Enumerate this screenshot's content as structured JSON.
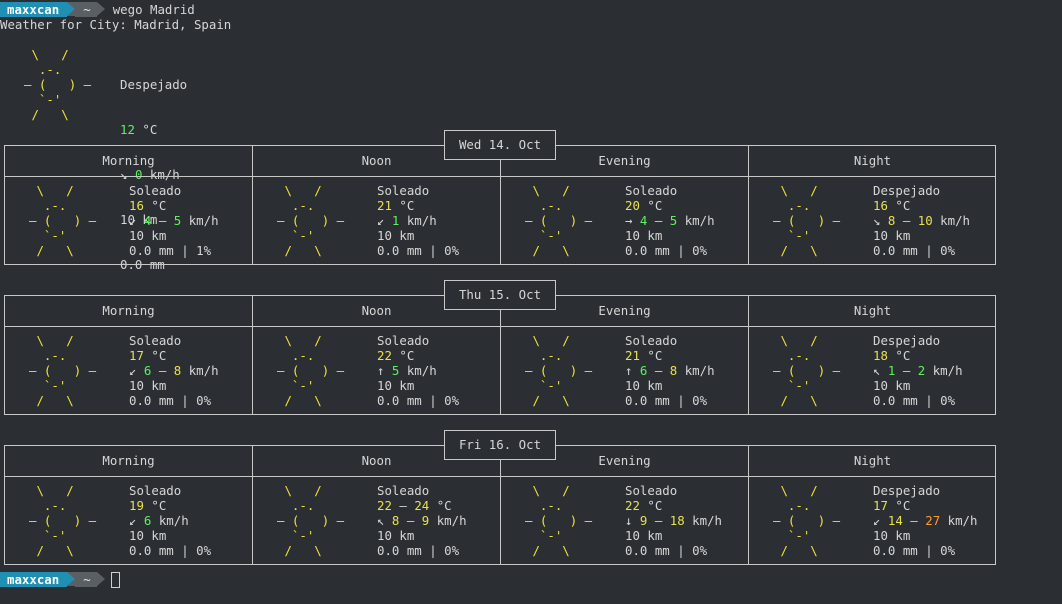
{
  "prompt": {
    "user": "maxxcan",
    "dir": "~",
    "command": "wego Madrid"
  },
  "header": "Weather for City: Madrid, Spain",
  "current": {
    "condition": "Despejado",
    "temp": "12",
    "temp_unit": " °C",
    "wind_arrow": "↘",
    "wind": "0",
    "wind_unit": " km/h",
    "visibility": "10 km",
    "precip": "0.0 mm"
  },
  "sun_art": [
    " \\   /",
    "  .-.",
    "― (   ) ―",
    "  `-'",
    " /   \\"
  ],
  "periods": [
    "Morning",
    "Noon",
    "Evening",
    "Night"
  ],
  "days": [
    {
      "date": "Wed 14. Oct",
      "slots": [
        {
          "cond": "Soleado",
          "temp": [
            "16"
          ],
          "arrow": "↙",
          "wind": [
            {
              "v": "4",
              "c": "g"
            },
            {
              "v": "5",
              "c": "g"
            }
          ],
          "vis": "10 km",
          "precip": "0.0 mm | 1%"
        },
        {
          "cond": "Soleado",
          "temp": [
            "21"
          ],
          "arrow": "↙",
          "wind": [
            {
              "v": "1",
              "c": "g"
            }
          ],
          "vis": "10 km",
          "precip": "0.0 mm | 0%"
        },
        {
          "cond": "Soleado",
          "temp": [
            "20"
          ],
          "arrow": "→",
          "wind": [
            {
              "v": "4",
              "c": "g"
            },
            {
              "v": "5",
              "c": "g"
            }
          ],
          "vis": "10 km",
          "precip": "0.0 mm | 0%"
        },
        {
          "cond": "Despejado",
          "temp": [
            "16"
          ],
          "arrow": "↘",
          "wind": [
            {
              "v": "8",
              "c": "y"
            },
            {
              "v": "10",
              "c": "y"
            }
          ],
          "vis": "10 km",
          "precip": "0.0 mm | 0%"
        }
      ]
    },
    {
      "date": "Thu 15. Oct",
      "slots": [
        {
          "cond": "Soleado",
          "temp": [
            "17"
          ],
          "arrow": "↙",
          "wind": [
            {
              "v": "6",
              "c": "g"
            },
            {
              "v": "8",
              "c": "y"
            }
          ],
          "vis": "10 km",
          "precip": "0.0 mm | 0%"
        },
        {
          "cond": "Soleado",
          "temp": [
            "22"
          ],
          "arrow": "↑",
          "wind": [
            {
              "v": "5",
              "c": "g"
            }
          ],
          "vis": "10 km",
          "precip": "0.0 mm | 0%"
        },
        {
          "cond": "Soleado",
          "temp": [
            "21"
          ],
          "arrow": "↑",
          "wind": [
            {
              "v": "6",
              "c": "g"
            },
            {
              "v": "8",
              "c": "y"
            }
          ],
          "vis": "10 km",
          "precip": "0.0 mm | 0%"
        },
        {
          "cond": "Despejado",
          "temp": [
            "18"
          ],
          "arrow": "↖",
          "wind": [
            {
              "v": "1",
              "c": "g"
            },
            {
              "v": "2",
              "c": "g"
            }
          ],
          "vis": "10 km",
          "precip": "0.0 mm | 0%"
        }
      ]
    },
    {
      "date": "Fri 16. Oct",
      "slots": [
        {
          "cond": "Soleado",
          "temp": [
            "19"
          ],
          "arrow": "↙",
          "wind": [
            {
              "v": "6",
              "c": "g"
            }
          ],
          "vis": "10 km",
          "precip": "0.0 mm | 0%"
        },
        {
          "cond": "Soleado",
          "temp": [
            "22",
            "24"
          ],
          "arrow": "↖",
          "wind": [
            {
              "v": "8",
              "c": "y"
            },
            {
              "v": "9",
              "c": "y"
            }
          ],
          "vis": "10 km",
          "precip": "0.0 mm | 0%"
        },
        {
          "cond": "Soleado",
          "temp": [
            "22"
          ],
          "arrow": "↓",
          "wind": [
            {
              "v": "9",
              "c": "y"
            },
            {
              "v": "18",
              "c": "y"
            }
          ],
          "vis": "10 km",
          "precip": "0.0 mm | 0%"
        },
        {
          "cond": "Despejado",
          "temp": [
            "17"
          ],
          "arrow": "↙",
          "wind": [
            {
              "v": "14",
              "c": "y"
            },
            {
              "v": "27",
              "c": "o"
            }
          ],
          "vis": "10 km",
          "precip": "0.0 mm | 0%"
        }
      ]
    }
  ],
  "temp_unit": " °C",
  "wind_unit": " km/h",
  "range_sep": " ― "
}
